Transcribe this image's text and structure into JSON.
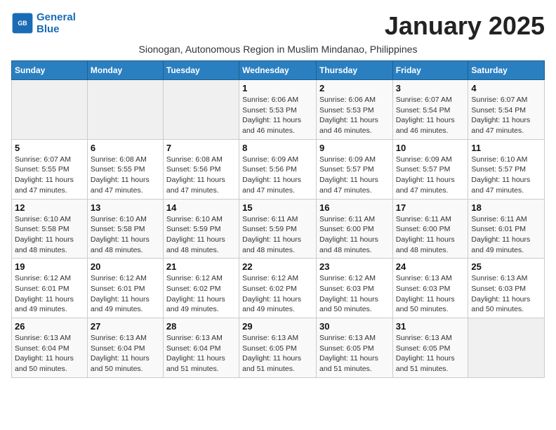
{
  "header": {
    "logo_line1": "General",
    "logo_line2": "Blue",
    "month": "January 2025",
    "subtitle": "Sionogan, Autonomous Region in Muslim Mindanao, Philippines"
  },
  "weekdays": [
    "Sunday",
    "Monday",
    "Tuesday",
    "Wednesday",
    "Thursday",
    "Friday",
    "Saturday"
  ],
  "weeks": [
    [
      {
        "day": "",
        "info": ""
      },
      {
        "day": "",
        "info": ""
      },
      {
        "day": "",
        "info": ""
      },
      {
        "day": "1",
        "info": "Sunrise: 6:06 AM\nSunset: 5:53 PM\nDaylight: 11 hours\nand 46 minutes."
      },
      {
        "day": "2",
        "info": "Sunrise: 6:06 AM\nSunset: 5:53 PM\nDaylight: 11 hours\nand 46 minutes."
      },
      {
        "day": "3",
        "info": "Sunrise: 6:07 AM\nSunset: 5:54 PM\nDaylight: 11 hours\nand 46 minutes."
      },
      {
        "day": "4",
        "info": "Sunrise: 6:07 AM\nSunset: 5:54 PM\nDaylight: 11 hours\nand 47 minutes."
      }
    ],
    [
      {
        "day": "5",
        "info": "Sunrise: 6:07 AM\nSunset: 5:55 PM\nDaylight: 11 hours\nand 47 minutes."
      },
      {
        "day": "6",
        "info": "Sunrise: 6:08 AM\nSunset: 5:55 PM\nDaylight: 11 hours\nand 47 minutes."
      },
      {
        "day": "7",
        "info": "Sunrise: 6:08 AM\nSunset: 5:56 PM\nDaylight: 11 hours\nand 47 minutes."
      },
      {
        "day": "8",
        "info": "Sunrise: 6:09 AM\nSunset: 5:56 PM\nDaylight: 11 hours\nand 47 minutes."
      },
      {
        "day": "9",
        "info": "Sunrise: 6:09 AM\nSunset: 5:57 PM\nDaylight: 11 hours\nand 47 minutes."
      },
      {
        "day": "10",
        "info": "Sunrise: 6:09 AM\nSunset: 5:57 PM\nDaylight: 11 hours\nand 47 minutes."
      },
      {
        "day": "11",
        "info": "Sunrise: 6:10 AM\nSunset: 5:57 PM\nDaylight: 11 hours\nand 47 minutes."
      }
    ],
    [
      {
        "day": "12",
        "info": "Sunrise: 6:10 AM\nSunset: 5:58 PM\nDaylight: 11 hours\nand 48 minutes."
      },
      {
        "day": "13",
        "info": "Sunrise: 6:10 AM\nSunset: 5:58 PM\nDaylight: 11 hours\nand 48 minutes."
      },
      {
        "day": "14",
        "info": "Sunrise: 6:10 AM\nSunset: 5:59 PM\nDaylight: 11 hours\nand 48 minutes."
      },
      {
        "day": "15",
        "info": "Sunrise: 6:11 AM\nSunset: 5:59 PM\nDaylight: 11 hours\nand 48 minutes."
      },
      {
        "day": "16",
        "info": "Sunrise: 6:11 AM\nSunset: 6:00 PM\nDaylight: 11 hours\nand 48 minutes."
      },
      {
        "day": "17",
        "info": "Sunrise: 6:11 AM\nSunset: 6:00 PM\nDaylight: 11 hours\nand 48 minutes."
      },
      {
        "day": "18",
        "info": "Sunrise: 6:11 AM\nSunset: 6:01 PM\nDaylight: 11 hours\nand 49 minutes."
      }
    ],
    [
      {
        "day": "19",
        "info": "Sunrise: 6:12 AM\nSunset: 6:01 PM\nDaylight: 11 hours\nand 49 minutes."
      },
      {
        "day": "20",
        "info": "Sunrise: 6:12 AM\nSunset: 6:01 PM\nDaylight: 11 hours\nand 49 minutes."
      },
      {
        "day": "21",
        "info": "Sunrise: 6:12 AM\nSunset: 6:02 PM\nDaylight: 11 hours\nand 49 minutes."
      },
      {
        "day": "22",
        "info": "Sunrise: 6:12 AM\nSunset: 6:02 PM\nDaylight: 11 hours\nand 49 minutes."
      },
      {
        "day": "23",
        "info": "Sunrise: 6:12 AM\nSunset: 6:03 PM\nDaylight: 11 hours\nand 50 minutes."
      },
      {
        "day": "24",
        "info": "Sunrise: 6:13 AM\nSunset: 6:03 PM\nDaylight: 11 hours\nand 50 minutes."
      },
      {
        "day": "25",
        "info": "Sunrise: 6:13 AM\nSunset: 6:03 PM\nDaylight: 11 hours\nand 50 minutes."
      }
    ],
    [
      {
        "day": "26",
        "info": "Sunrise: 6:13 AM\nSunset: 6:04 PM\nDaylight: 11 hours\nand 50 minutes."
      },
      {
        "day": "27",
        "info": "Sunrise: 6:13 AM\nSunset: 6:04 PM\nDaylight: 11 hours\nand 50 minutes."
      },
      {
        "day": "28",
        "info": "Sunrise: 6:13 AM\nSunset: 6:04 PM\nDaylight: 11 hours\nand 51 minutes."
      },
      {
        "day": "29",
        "info": "Sunrise: 6:13 AM\nSunset: 6:05 PM\nDaylight: 11 hours\nand 51 minutes."
      },
      {
        "day": "30",
        "info": "Sunrise: 6:13 AM\nSunset: 6:05 PM\nDaylight: 11 hours\nand 51 minutes."
      },
      {
        "day": "31",
        "info": "Sunrise: 6:13 AM\nSunset: 6:05 PM\nDaylight: 11 hours\nand 51 minutes."
      },
      {
        "day": "",
        "info": ""
      }
    ]
  ]
}
